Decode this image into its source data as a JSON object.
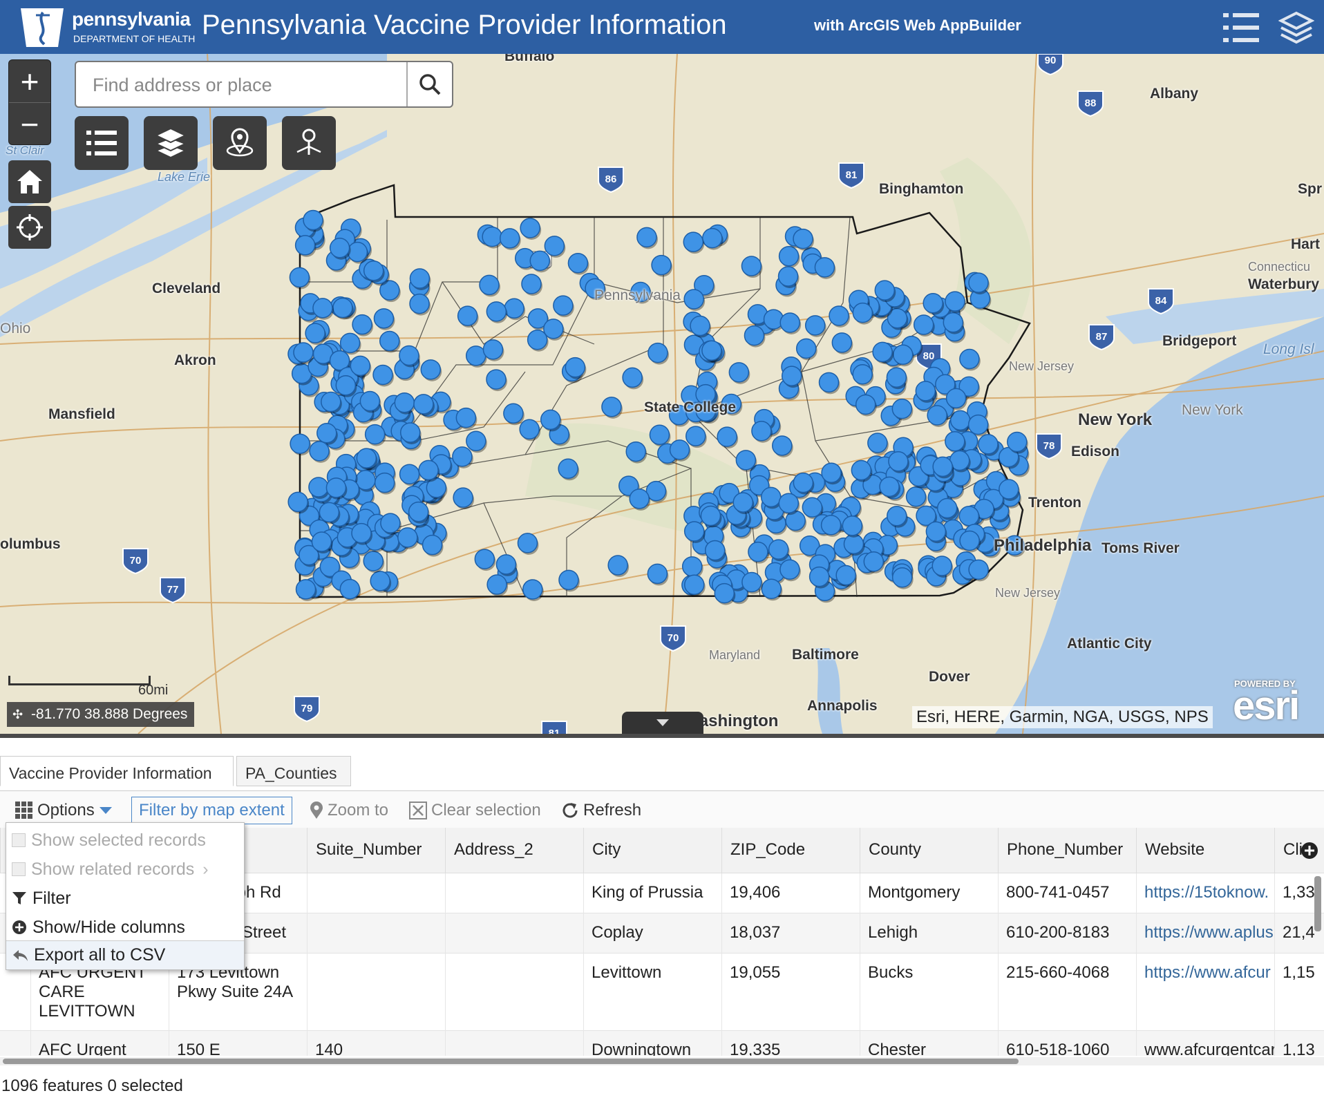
{
  "header": {
    "logo_name": "pennsylvania",
    "logo_dept": "DEPARTMENT OF HEALTH",
    "title": "Pennsylvania Vaccine Provider Information",
    "subtitle": "with ArcGIS Web AppBuilder",
    "icons": [
      "list-icon",
      "layers-icon"
    ]
  },
  "search": {
    "placeholder": "Find address or place"
  },
  "map": {
    "zoom_in": "+",
    "zoom_out": "−",
    "scale_label": "60mi",
    "coordinates": "-81.770 38.888 Degrees",
    "attribution": "Esri, HERE, Garmin, NGA, USGS, NPS",
    "esri_powered": "POWERED BY",
    "esri_logo": "esri",
    "provider_marker_color": "#3f93e6",
    "labels": {
      "buffalo": "Buffalo",
      "albany": "Albany",
      "binghamton": "Binghamton",
      "hartford": "Hart",
      "waterbury": "Waterbury",
      "cleveland": "Cleveland",
      "akron": "Akron",
      "mansfield": "Mansfield",
      "ohio": "Ohio",
      "columbus": "olumbus",
      "bridgeport": "Bridgeport",
      "long_island": "Long Isl",
      "new_york_city": "New York",
      "new_york_state": "New York",
      "new_jersey_1": "New Jersey",
      "new_jersey_2": "New Jersey",
      "edison": "Edison",
      "trenton": "Trenton",
      "philadelphia": "Philadelphia",
      "toms_river": "Toms River",
      "atlantic_city": "Atlantic City",
      "baltimore": "Baltimore",
      "maryland": "Maryland",
      "dover": "Dover",
      "annapolis": "Annapolis",
      "washington": "Washington",
      "state_college": "State College",
      "pennsylvania": "Pennsylvania",
      "lake_erie": "Lake Erie",
      "st_clair": "St Clair",
      "spr": "Spr",
      "connecticut": "Connecticu"
    }
  },
  "panel": {
    "tabs": [
      "Vaccine Provider Information",
      "PA_Counties"
    ],
    "toolbar": {
      "options": "Options",
      "filter_extent": "Filter by map extent",
      "zoom_to": "Zoom to",
      "clear_selection": "Clear selection",
      "refresh": "Refresh"
    },
    "menu": [
      "Show selected records",
      "Show related records",
      "Filter",
      "Show/Hide columns",
      "Export all to CSV"
    ],
    "columns": [
      "Suite_Number",
      "Address_2",
      "City",
      "ZIP_Code",
      "County",
      "Phone_Number",
      "Website",
      "Cli"
    ],
    "rows": [
      {
        "name": "",
        "address": "ulph Rd",
        "suite": "",
        "addr2": "",
        "city": "King of Prussia",
        "zip": "19,406",
        "county": "Montgomery",
        "phone": "800-741-0457",
        "website": "https://15toknow.",
        "cli": "1,33"
      },
      {
        "name": "",
        "address": "Street",
        "suite": "",
        "addr2": "",
        "city": "Coplay",
        "zip": "18,037",
        "county": "Lehigh",
        "phone": "610-200-8183",
        "website": "https://www.aplus",
        "cli": "21,4"
      },
      {
        "name": "AFC URGENT CARE LEVITTOWN",
        "address": "173 Levittown Pkwy Suite 24A",
        "suite": "",
        "addr2": "",
        "city": "Levittown",
        "zip": "19,055",
        "county": "Bucks",
        "phone": "215-660-4068",
        "website": "https://www.afcur",
        "cli": "1,15"
      },
      {
        "name": "AFC Urgent",
        "address": "150 E",
        "suite": "140",
        "addr2": "",
        "city": "Downingtown",
        "zip": "19,335",
        "county": "Chester",
        "phone": "610-518-1060",
        "website": "www.afcurgentcar",
        "cli": "1,13"
      }
    ],
    "status": "1096 features 0 selected"
  }
}
